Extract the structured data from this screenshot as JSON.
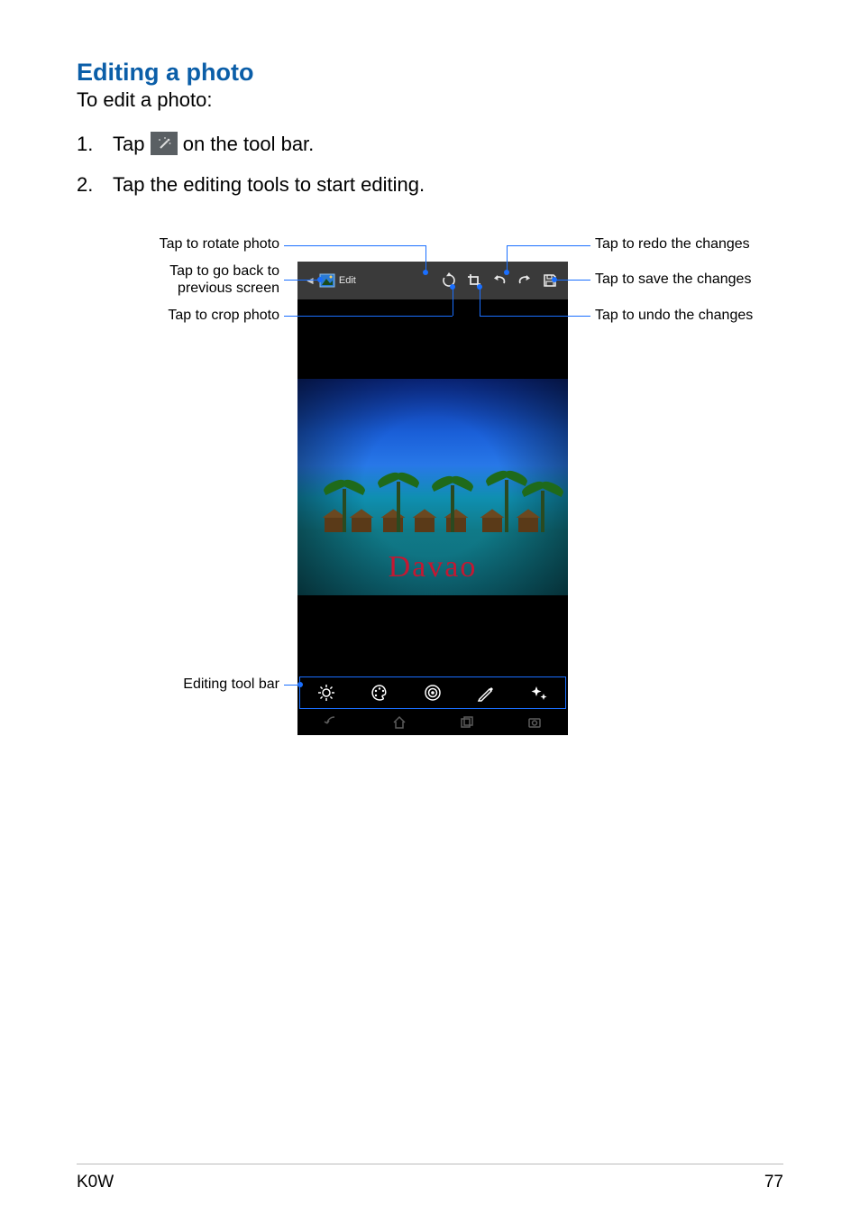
{
  "heading": "Editing a photo",
  "intro": "To edit a photo:",
  "steps": {
    "one_num": "1.",
    "one_a": "Tap ",
    "one_b": " on the tool bar.",
    "two_num": "2.",
    "two": "Tap the editing tools to start editing."
  },
  "callouts": {
    "rotate": "Tap to rotate photo",
    "back_line1": "Tap to go back to",
    "back_line2": "previous screen",
    "crop": "Tap to crop photo",
    "redo": "Tap to redo the changes",
    "save": "Tap to save the changes",
    "undo": "Tap to undo the changes",
    "editbar": "Editing tool bar"
  },
  "device": {
    "edit_label": "Edit",
    "photo_caption": "Davao"
  },
  "footer": {
    "left": "K0W",
    "right": "77"
  }
}
